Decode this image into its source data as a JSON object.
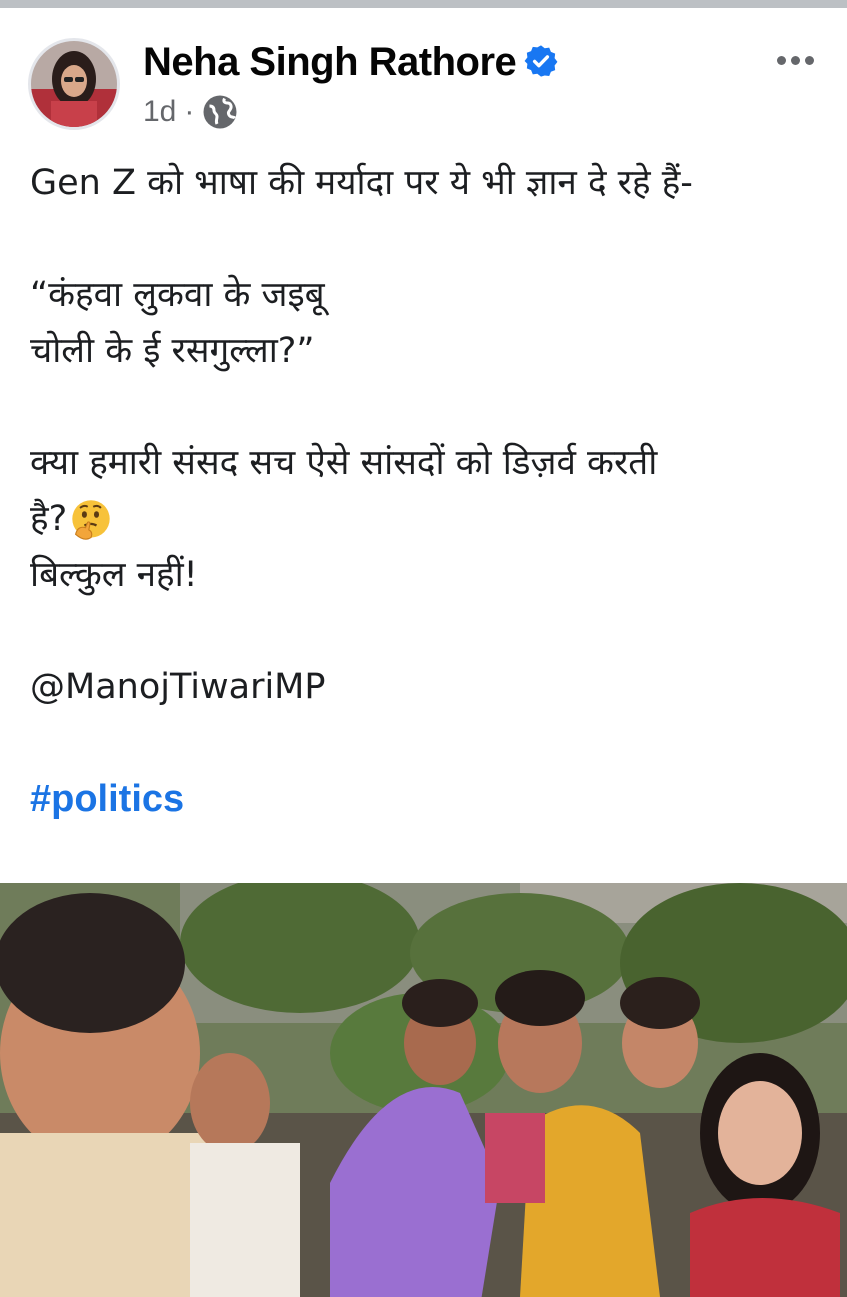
{
  "post": {
    "author": "Neha Singh Rathore",
    "time": "1d",
    "separator": "·",
    "privacy_icon": "globe-icon",
    "verified_icon": "verified-badge-icon",
    "more_icon": "more-options-icon",
    "lines": {
      "l1": "Gen Z को भाषा की मर्यादा पर ये भी ज्ञान दे रहे हैं-",
      "l2": "“कंहवा लुकवा के जइबू",
      "l3": "चोली के ई रसगुल्ला?”",
      "l4": "क्या हमारी संसद सच ऐसे सांसदों को डिज़र्व करती",
      "l5": "है?",
      "l6": "बिल्कुल नहीं!",
      "mention": "@ManojTiwariMP",
      "hashtag": "#politics"
    },
    "emoji": "thinking-face-icon"
  },
  "colors": {
    "verified": "#1877f2",
    "hashtag": "#1b74e4",
    "meta": "#65676b"
  }
}
